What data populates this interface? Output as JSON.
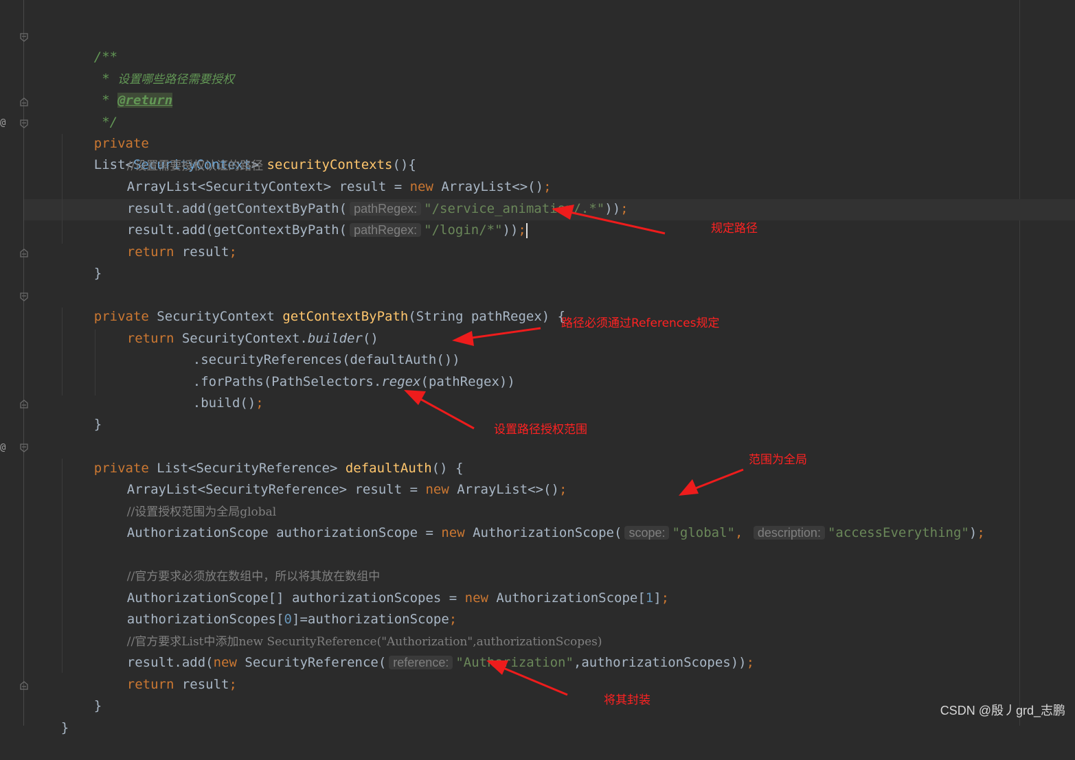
{
  "javadoc": {
    "open": "/**",
    "star1": " * ",
    "desc": "设置哪些路径需要授权",
    "star2": " * ",
    "tag": "@return",
    "close": " */"
  },
  "method_security_contexts": {
    "modifier": "private",
    "ret_type": "List",
    "generic_type": "SecurityContext",
    "name": "securityContexts",
    "sig_tail": "(){",
    "comment": "//设置需要授权认证的路径",
    "line_result_decl": "ArrayList<SecurityContext> result = ",
    "new_kw": "new",
    "line_result_init": " ArrayList<>()",
    "add_prefix": "result.add(getContextByPath(",
    "hint_pathregex": "pathRegex:",
    "path1": "\"/service_animation/.*\"",
    "path2": "\"/login/*\"",
    "add_suffix": "))",
    "return_kw": "return",
    "return_val": " result",
    "close_brace": "}"
  },
  "method_get_context": {
    "modifier": "private",
    "sig_type": " SecurityContext ",
    "name": "getContextByPath",
    "params": "(String pathRegex) {",
    "return_kw": "return",
    "builder_prefix": " SecurityContext.",
    "builder_call": "builder",
    "builder_suffix": "()",
    "sec_refs": ".securityReferences(defaultAuth())",
    "for_paths_a": ".forPaths(PathSelectors.",
    "regex_call": "regex",
    "for_paths_b": "(pathRegex))",
    "build": ".build()",
    "close_brace": "}"
  },
  "method_default_auth": {
    "modifier": "private",
    "sig_type": " List<SecurityReference> ",
    "name": "defaultAuth",
    "sig_tail": "() {",
    "result_decl": "ArrayList<SecurityReference> result = ",
    "new_kw": "new",
    "result_init": " ArrayList<>()",
    "comment1": "//设置授权范围为全局global",
    "scope_decl": "AuthorizationScope authorizationScope = ",
    "scope_ctor": " AuthorizationScope(",
    "hint_scope": "scope:",
    "scope_val": "\"global\"",
    "comma": ", ",
    "hint_desc": "description:",
    "desc_val": "\"accessEverything\"",
    "scope_close": ")",
    "comment2": "//官方要求必须放在数组中，所以将其放在数组中",
    "scopes_decl": "AuthorizationScope[] authorizationScopes = ",
    "scopes_ctor": " AuthorizationScope[",
    "scopes_size": "1",
    "scopes_close": "]",
    "assign_a": "authorizationScopes[",
    "assign_idx": "0",
    "assign_b": "]=authorizationScope",
    "comment3": "//官方要求List中添加new SecurityReference(\"Authorization\",authorizationScopes)",
    "add_prefix": "result.add(",
    "ref_ctor": " SecurityReference(",
    "hint_reference": "reference:",
    "ref_val": "\"Authorization\"",
    "ref_tail": ",authorizationScopes))",
    "return_kw": "return",
    "return_val": " result",
    "close_brace": "}",
    "class_close": "}"
  },
  "semicolon": ";",
  "annotations": {
    "note1": "规定路径",
    "note2": "路径必须通过References规定",
    "note3": "设置路径授权范围",
    "note4": "范围为全局",
    "note5": "将其封装"
  },
  "watermark": "CSDN @殷丿grd_志鹏",
  "colors": {
    "background": "#2b2b2b",
    "keyword": "#cc7832",
    "method": "#ffc66d",
    "string": "#6a8759",
    "number": "#6897bb",
    "comment": "#808080",
    "doc_comment": "#629755",
    "annotation_red": "#ff2222"
  },
  "icons": [
    "fold-marker-icon",
    "override-marker-icon",
    "arrow-icon"
  ]
}
